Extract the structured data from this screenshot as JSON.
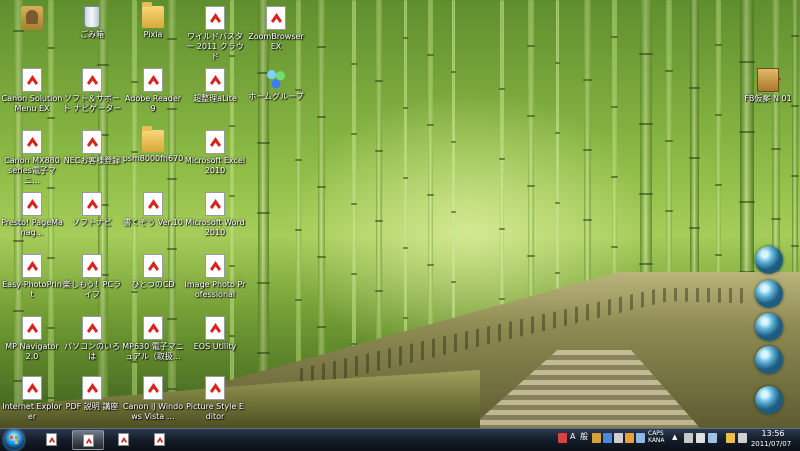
{
  "desktop": {
    "icons": [
      {
        "label": "",
        "icon": "user-folder-icon"
      },
      {
        "label": "ごみ箱",
        "icon": "recycle-bin-icon"
      },
      {
        "label": "Pixla",
        "icon": "folder-icon"
      },
      {
        "label": "ワイルドバスター 2011 クラウド",
        "icon": "pdf-icon"
      },
      {
        "label": "ZoomBrowser EX",
        "icon": "pdf-icon"
      },
      {
        "label": "Canon Solution Menu EX",
        "icon": "pdf-icon"
      },
      {
        "label": "ソフト＆サポート ナビゲーター",
        "icon": "pdf-icon"
      },
      {
        "label": "Adobe Reader 9",
        "icon": "pdf-icon"
      },
      {
        "label": "超整理aLite",
        "icon": "pdf-icon"
      },
      {
        "label": "ホームグループ",
        "icon": "homegroup-icon"
      },
      {
        "label": "Canon MX880 series電子マニ…",
        "icon": "pdf-icon"
      },
      {
        "label": "NECお客様登録",
        "icon": "pdf-icon"
      },
      {
        "label": "psm8000fh670",
        "icon": "folder-icon"
      },
      {
        "label": "Microsoft Excel 2010",
        "icon": "pdf-icon"
      },
      {
        "label": "Presto! PageManag...",
        "icon": "pdf-icon"
      },
      {
        "label": "ソフトナビ",
        "icon": "pdf-icon"
      },
      {
        "label": "書くぞう Ver.10",
        "icon": "pdf-icon"
      },
      {
        "label": "Microsoft Word 2010",
        "icon": "pdf-icon"
      },
      {
        "label": "Easy-PhotoPrint",
        "icon": "pdf-icon"
      },
      {
        "label": "楽しもう！PCライフ",
        "icon": "pdf-icon"
      },
      {
        "label": "ひとつのCD",
        "icon": "pdf-icon"
      },
      {
        "label": "Image Photo Professional",
        "icon": "pdf-icon"
      },
      {
        "label": "MP Navigator 2.0",
        "icon": "pdf-icon"
      },
      {
        "label": "パソコンのいろは",
        "icon": "pdf-icon"
      },
      {
        "label": "MP630 電子マニュアル（取扱…",
        "icon": "pdf-icon"
      },
      {
        "label": "EOS Utility",
        "icon": "pdf-icon"
      },
      {
        "label": "Internet Explorer",
        "icon": "pdf-icon"
      },
      {
        "label": "PDF 説明 講座",
        "icon": "pdf-icon"
      },
      {
        "label": "Canon iJ Windows Vista …",
        "icon": "pdf-icon"
      },
      {
        "label": "Picture Style Editor",
        "icon": "pdf-icon"
      },
      {
        "label": "FB仮案 N 01",
        "icon": "archive-box-icon"
      }
    ]
  },
  "gadgets": [
    "gadget-orb-1",
    "gadget-orb-2",
    "gadget-orb-3",
    "gadget-orb-4",
    "gadget-orb-5"
  ],
  "taskbar": {
    "start": "start-button",
    "pinned": [
      {
        "name": "task-pdf-1",
        "active": false
      },
      {
        "name": "task-pdf-2",
        "active": true
      },
      {
        "name": "task-pdf-3",
        "active": false
      },
      {
        "name": "task-pdf-4",
        "active": false
      }
    ],
    "tray": {
      "ime_a": "A",
      "ime_mode": "般",
      "lang_text": "CAPS KANA",
      "time": "13:56",
      "date": "2011/07/07"
    }
  },
  "colors": {
    "taskbar": "#141d29",
    "bamboo": "#7fb33a"
  }
}
